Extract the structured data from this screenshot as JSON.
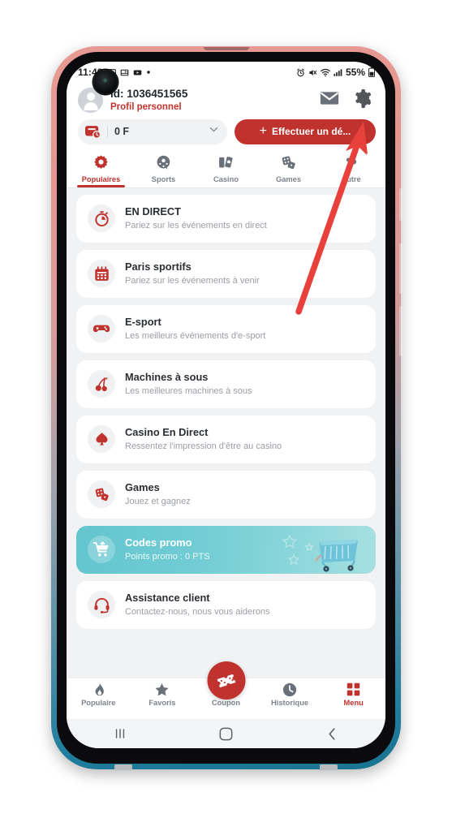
{
  "status_bar": {
    "time": "11:48",
    "left_icons": [
      "image-icon",
      "screenshot-icon",
      "video-icon",
      "dot-icon"
    ],
    "right_icons": [
      "alarm-icon",
      "mute-icon",
      "wifi-icon",
      "signal-icon"
    ],
    "battery_percent": "55%"
  },
  "header": {
    "account_id": "id: 1036451565",
    "profile_link": "Profil personnel",
    "mail_icon": "envelope-icon",
    "settings_icon": "gear-icon"
  },
  "balance": {
    "wallet_icon": "wallet-icon",
    "amount": "0 F",
    "chevron_icon": "chevron-down-icon",
    "deposit_plus": "+",
    "deposit_label": "Effectuer un dé..."
  },
  "category_tabs": [
    {
      "label": "Populaires",
      "icon": "flower-gear-icon",
      "active": true
    },
    {
      "label": "Sports",
      "icon": "soccer-ball-icon",
      "active": false
    },
    {
      "label": "Casino",
      "icon": "playing-cards-icon",
      "active": false
    },
    {
      "label": "Games",
      "icon": "dice-icon",
      "active": false
    },
    {
      "label": "Autre",
      "icon": "dots-icon",
      "active": false
    }
  ],
  "menu_items": [
    {
      "title": "EN DIRECT",
      "subtitle": "Pariez sur les événements en direct",
      "icon": "stopwatch-icon",
      "promo": false
    },
    {
      "title": "Paris sportifs",
      "subtitle": "Pariez sur les événements à venir",
      "icon": "calendar-icon",
      "promo": false
    },
    {
      "title": "E-sport",
      "subtitle": "Les meilleurs événements d'e-sport",
      "icon": "gamepad-icon",
      "promo": false
    },
    {
      "title": "Machines à sous",
      "subtitle": "Les meilleures machines à sous",
      "icon": "cherries-icon",
      "promo": false
    },
    {
      "title": "Casino En Direct",
      "subtitle": "Ressentez l'impression d'être au casino",
      "icon": "spade-icon",
      "promo": false
    },
    {
      "title": "Games",
      "subtitle": "Jouez et gagnez",
      "icon": "dice-icon",
      "promo": false
    },
    {
      "title": "Codes promo",
      "subtitle": "Points promo : 0 PTS",
      "icon": "shopping-cart-icon",
      "promo": true
    },
    {
      "title": "Assistance client",
      "subtitle": "Contactez-nous, nous vous aiderons",
      "icon": "headset-icon",
      "promo": false
    }
  ],
  "bottom_nav": [
    {
      "label": "Populaire",
      "icon": "flame-icon",
      "active": false
    },
    {
      "label": "Favoris",
      "icon": "star-icon",
      "active": false
    },
    {
      "label": "Coupon",
      "icon": "ticket-icon",
      "active": false
    },
    {
      "label": "Historique",
      "icon": "clock-icon",
      "active": false
    },
    {
      "label": "Menu",
      "icon": "grid-icon",
      "active": true
    }
  ],
  "android_nav": {
    "recents": "recents-icon",
    "home": "home-icon",
    "back": "back-icon"
  },
  "annotation": {
    "type": "arrow",
    "color": "#e8413c",
    "points_to": "gear-icon"
  },
  "colors": {
    "brand_red": "#c0322e",
    "promo_teal": "#72cdd4",
    "screen_bg": "#f1f2f4",
    "card_bg": "#ffffff",
    "muted_text": "#9a9ea4"
  }
}
